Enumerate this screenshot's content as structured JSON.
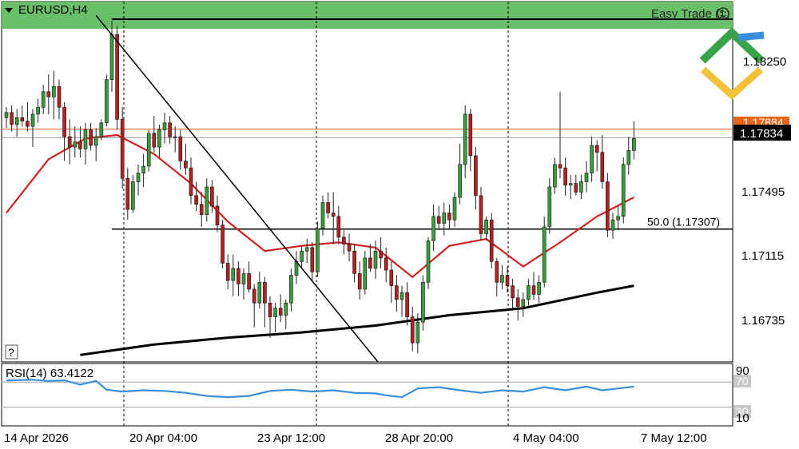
{
  "window": {
    "symbol_label": "EURUSD,H4",
    "top_right_label": "Easy Trade (1)",
    "help_label": "?"
  },
  "colors": {
    "bull": "#3a9c3a",
    "bear": "#b22222",
    "wick": "#222222",
    "band": "#6abf6a",
    "ma_fast": "#d42020",
    "ma_slow": "#000000",
    "rsi": "#3a8fd9",
    "price_line": "#e8651a",
    "bid_box": "#000000",
    "logo_green": "#3aa34a",
    "logo_yellow": "#f2c13c",
    "logo_blue": "#3a8fd9"
  },
  "icons": {
    "menu": "triangle-down-icon",
    "brand": "broker-logo-icon"
  },
  "price_axis": {
    "ticks": [
      "1.18250",
      "1.17495",
      "1.17115",
      "1.16735"
    ],
    "current_price": "1.17834",
    "upper_price": "1.17884",
    "fib_level_label": "50.0 (1.17307)"
  },
  "time_axis": {
    "labels": [
      "14 Apr 2026",
      "20 Apr 04:00",
      "23 Apr 12:00",
      "28 Apr 20:00",
      "4 May 04:00",
      "7 May 12:00"
    ]
  },
  "rsi_panel": {
    "label": "RSI(14) 63.4122",
    "scale_top": "90",
    "scale_bottom": "10",
    "level_high": "70",
    "level_low": "30"
  },
  "chart_data": [
    {
      "type": "candlestick",
      "title": "EURUSD,H4",
      "x_labels": [
        "14 Apr 2026",
        "20 Apr 04:00",
        "23 Apr 12:00",
        "28 Apr 20:00",
        "4 May 04:00",
        "7 May 12:00"
      ],
      "ylim": [
        1.1654,
        1.1862
      ],
      "y_ticks": [
        1.1825,
        1.17495,
        1.17115,
        1.16735
      ],
      "fib_level": 1.17307,
      "current_price": 1.17834,
      "candles": [
        [
          1.1795,
          1.1801,
          1.1789,
          1.1798
        ],
        [
          1.1798,
          1.1802,
          1.1787,
          1.1791
        ],
        [
          1.1791,
          1.18,
          1.1784,
          1.1795
        ],
        [
          1.1795,
          1.1802,
          1.179,
          1.1793
        ],
        [
          1.1793,
          1.1804,
          1.1787,
          1.179
        ],
        [
          1.179,
          1.18,
          1.1778,
          1.1797
        ],
        [
          1.1797,
          1.1806,
          1.1792,
          1.1801
        ],
        [
          1.1801,
          1.1814,
          1.1797,
          1.181
        ],
        [
          1.181,
          1.182,
          1.1797,
          1.1807
        ],
        [
          1.1807,
          1.1822,
          1.1794,
          1.1813
        ],
        [
          1.1813,
          1.1817,
          1.1794,
          1.1801
        ],
        [
          1.1801,
          1.1804,
          1.177,
          1.1784
        ],
        [
          1.1784,
          1.1794,
          1.1768,
          1.1778
        ],
        [
          1.1778,
          1.179,
          1.1772,
          1.1781
        ],
        [
          1.1781,
          1.179,
          1.1772,
          1.1777
        ],
        [
          1.1777,
          1.1792,
          1.1768,
          1.1788
        ],
        [
          1.1788,
          1.1792,
          1.1776,
          1.1779
        ],
        [
          1.1779,
          1.1789,
          1.177,
          1.1784
        ],
        [
          1.1784,
          1.1794,
          1.1782,
          1.1792
        ],
        [
          1.1792,
          1.182,
          1.179,
          1.1817
        ],
        [
          1.1817,
          1.1851,
          1.181,
          1.1843
        ],
        [
          1.1843,
          1.1848,
          1.1788,
          1.1794
        ],
        [
          1.1794,
          1.1801,
          1.1754,
          1.176
        ],
        [
          1.176,
          1.1766,
          1.1736,
          1.1742
        ],
        [
          1.1742,
          1.1762,
          1.174,
          1.1758
        ],
        [
          1.1758,
          1.1768,
          1.175,
          1.1763
        ],
        [
          1.1763,
          1.1774,
          1.1755,
          1.1767
        ],
        [
          1.1767,
          1.1788,
          1.1764,
          1.1786
        ],
        [
          1.1786,
          1.1796,
          1.1775,
          1.1778
        ],
        [
          1.1778,
          1.1791,
          1.1772,
          1.1788
        ],
        [
          1.1788,
          1.1798,
          1.178,
          1.1792
        ],
        [
          1.1792,
          1.1796,
          1.178,
          1.1784
        ],
        [
          1.1784,
          1.179,
          1.1775,
          1.1784
        ],
        [
          1.1784,
          1.1788,
          1.1765,
          1.177
        ],
        [
          1.177,
          1.178,
          1.1762,
          1.1766
        ],
        [
          1.1766,
          1.1772,
          1.1745,
          1.175
        ],
        [
          1.175,
          1.1758,
          1.1741,
          1.1745
        ],
        [
          1.1745,
          1.1752,
          1.1732,
          1.1739
        ],
        [
          1.1739,
          1.176,
          1.1735,
          1.1755
        ],
        [
          1.1755,
          1.1759,
          1.174,
          1.1744
        ],
        [
          1.1744,
          1.175,
          1.1729,
          1.1733
        ],
        [
          1.1733,
          1.1736,
          1.1708,
          1.1711
        ],
        [
          1.1711,
          1.1716,
          1.1696,
          1.1701
        ],
        [
          1.1701,
          1.1716,
          1.1692,
          1.1708
        ],
        [
          1.1708,
          1.1712,
          1.1692,
          1.1699
        ],
        [
          1.1699,
          1.1708,
          1.169,
          1.1705
        ],
        [
          1.1705,
          1.1712,
          1.1694,
          1.1696
        ],
        [
          1.1696,
          1.1699,
          1.1674,
          1.1688
        ],
        [
          1.1688,
          1.1706,
          1.1685,
          1.17
        ],
        [
          1.17,
          1.1703,
          1.1674,
          1.1688
        ],
        [
          1.1688,
          1.1692,
          1.1668,
          1.168
        ],
        [
          1.168,
          1.1688,
          1.1671,
          1.1685
        ],
        [
          1.1685,
          1.1693,
          1.1677,
          1.1681
        ],
        [
          1.1681,
          1.169,
          1.1673,
          1.1688
        ],
        [
          1.1688,
          1.1708,
          1.1683,
          1.1704
        ],
        [
          1.1704,
          1.1718,
          1.1699,
          1.1712
        ],
        [
          1.1712,
          1.1721,
          1.1708,
          1.1718
        ],
        [
          1.1718,
          1.1725,
          1.1711,
          1.172
        ],
        [
          1.172,
          1.1723,
          1.17,
          1.1706
        ],
        [
          1.1706,
          1.1735,
          1.1703,
          1.1731
        ],
        [
          1.1731,
          1.175,
          1.1727,
          1.1746
        ],
        [
          1.1746,
          1.1752,
          1.1737,
          1.174
        ],
        [
          1.174,
          1.1752,
          1.1722,
          1.1738
        ],
        [
          1.1738,
          1.1744,
          1.1722,
          1.1726
        ],
        [
          1.1726,
          1.173,
          1.1716,
          1.1722
        ],
        [
          1.1722,
          1.1728,
          1.1712,
          1.1718
        ],
        [
          1.1718,
          1.1722,
          1.17,
          1.1705
        ],
        [
          1.1705,
          1.1712,
          1.169,
          1.1696
        ],
        [
          1.1696,
          1.1718,
          1.1693,
          1.1714
        ],
        [
          1.1714,
          1.1722,
          1.1706,
          1.1708
        ],
        [
          1.1708,
          1.1724,
          1.1702,
          1.1718
        ],
        [
          1.1718,
          1.1726,
          1.1708,
          1.1714
        ],
        [
          1.1714,
          1.172,
          1.17,
          1.1707
        ],
        [
          1.1707,
          1.1712,
          1.1688,
          1.1698
        ],
        [
          1.1698,
          1.1704,
          1.1683,
          1.169
        ],
        [
          1.169,
          1.1698,
          1.168,
          1.1694
        ],
        [
          1.1694,
          1.17,
          1.1675,
          1.168
        ],
        [
          1.168,
          1.1686,
          1.166,
          1.1665
        ],
        [
          1.1665,
          1.1682,
          1.1659,
          1.1677
        ],
        [
          1.1677,
          1.1704,
          1.1672,
          1.17
        ],
        [
          1.17,
          1.1726,
          1.1696,
          1.1724
        ],
        [
          1.1724,
          1.1745,
          1.1718,
          1.1738
        ],
        [
          1.1738,
          1.1744,
          1.173,
          1.1734
        ],
        [
          1.1734,
          1.1746,
          1.1727,
          1.174
        ],
        [
          1.174,
          1.1745,
          1.1731,
          1.1736
        ],
        [
          1.1736,
          1.1752,
          1.1732,
          1.1749
        ],
        [
          1.1749,
          1.178,
          1.1745,
          1.1768
        ],
        [
          1.1768,
          1.1802,
          1.176,
          1.1797
        ],
        [
          1.1797,
          1.18,
          1.1764,
          1.1773
        ],
        [
          1.1773,
          1.1778,
          1.1742,
          1.175
        ],
        [
          1.175,
          1.1755,
          1.1724,
          1.1728
        ],
        [
          1.1728,
          1.1738,
          1.1724,
          1.1736
        ],
        [
          1.1736,
          1.174,
          1.1708,
          1.1712
        ],
        [
          1.1712,
          1.1714,
          1.1692,
          1.17
        ],
        [
          1.17,
          1.171,
          1.1696,
          1.1704
        ],
        [
          1.1704,
          1.1709,
          1.1694,
          1.1698
        ],
        [
          1.1698,
          1.1702,
          1.1685,
          1.1691
        ],
        [
          1.1691,
          1.1696,
          1.1678,
          1.1686
        ],
        [
          1.1686,
          1.1694,
          1.168,
          1.169
        ],
        [
          1.169,
          1.1702,
          1.1686,
          1.1698
        ],
        [
          1.1698,
          1.1706,
          1.169,
          1.1693
        ],
        [
          1.1693,
          1.1704,
          1.1688,
          1.17
        ],
        [
          1.17,
          1.1738,
          1.1697,
          1.1732
        ],
        [
          1.1732,
          1.176,
          1.1728,
          1.1755
        ],
        [
          1.1755,
          1.1772,
          1.1751,
          1.1768
        ],
        [
          1.1768,
          1.181,
          1.176,
          1.1766
        ],
        [
          1.1766,
          1.1772,
          1.175,
          1.1756
        ],
        [
          1.1756,
          1.1762,
          1.1748,
          1.1757
        ],
        [
          1.1757,
          1.1762,
          1.175,
          1.1752
        ],
        [
          1.1752,
          1.1762,
          1.1748,
          1.1758
        ],
        [
          1.1758,
          1.177,
          1.1752,
          1.1763
        ],
        [
          1.1763,
          1.1784,
          1.1758,
          1.1779
        ],
        [
          1.1779,
          1.1782,
          1.1764,
          1.1775
        ],
        [
          1.1775,
          1.1785,
          1.1754,
          1.1758
        ],
        [
          1.1758,
          1.1763,
          1.1726,
          1.173
        ],
        [
          1.173,
          1.174,
          1.1725,
          1.1736
        ],
        [
          1.1736,
          1.1744,
          1.173,
          1.1738
        ],
        [
          1.1738,
          1.1772,
          1.1734,
          1.1768
        ],
        [
          1.1768,
          1.1784,
          1.1762,
          1.1776
        ],
        [
          1.1776,
          1.1793,
          1.1771,
          1.1783
        ]
      ],
      "series": [
        {
          "name": "",
          "type": "line",
          "x_index": [
            0,
            8,
            15,
            21,
            28,
            35,
            42,
            49,
            56,
            63,
            70,
            77,
            84,
            91,
            98,
            105,
            112,
            119
          ],
          "values": [
            1.174,
            1.1771,
            1.1783,
            1.1785,
            1.1774,
            1.1757,
            1.1735,
            1.1718,
            1.1721,
            1.1723,
            1.172,
            1.1703,
            1.1721,
            1.1725,
            1.1709,
            1.1723,
            1.1738,
            1.1749
          ]
        },
        {
          "name": "",
          "type": "line",
          "x_index": [
            14,
            28,
            42,
            56,
            70,
            84,
            98,
            112,
            119
          ],
          "values": [
            1.1658,
            1.1664,
            1.1668,
            1.1671,
            1.1675,
            1.1681,
            1.1685,
            1.1694,
            1.1698
          ]
        }
      ],
      "trendline": {
        "from": [
          17,
          1.1854
        ],
        "to": [
          71,
          1.1652
        ]
      }
    },
    {
      "type": "line",
      "title": "RSI(14) 63.4122",
      "ylim": [
        0,
        100
      ],
      "levels": [
        70,
        30
      ],
      "x_index": [
        0,
        5,
        8,
        11,
        14,
        17,
        19,
        22,
        26,
        30,
        34,
        38,
        42,
        46,
        50,
        54,
        58,
        62,
        66,
        70,
        72,
        75,
        78,
        82,
        86,
        90,
        94,
        98,
        102,
        106,
        110,
        113,
        116,
        119
      ],
      "values": [
        73,
        74,
        72,
        73,
        66,
        72,
        58,
        55,
        57,
        56,
        53,
        48,
        46,
        48,
        56,
        58,
        55,
        57,
        53,
        52,
        49,
        46,
        60,
        62,
        57,
        53,
        57,
        55,
        62,
        57,
        63,
        57,
        60,
        63
      ]
    }
  ]
}
